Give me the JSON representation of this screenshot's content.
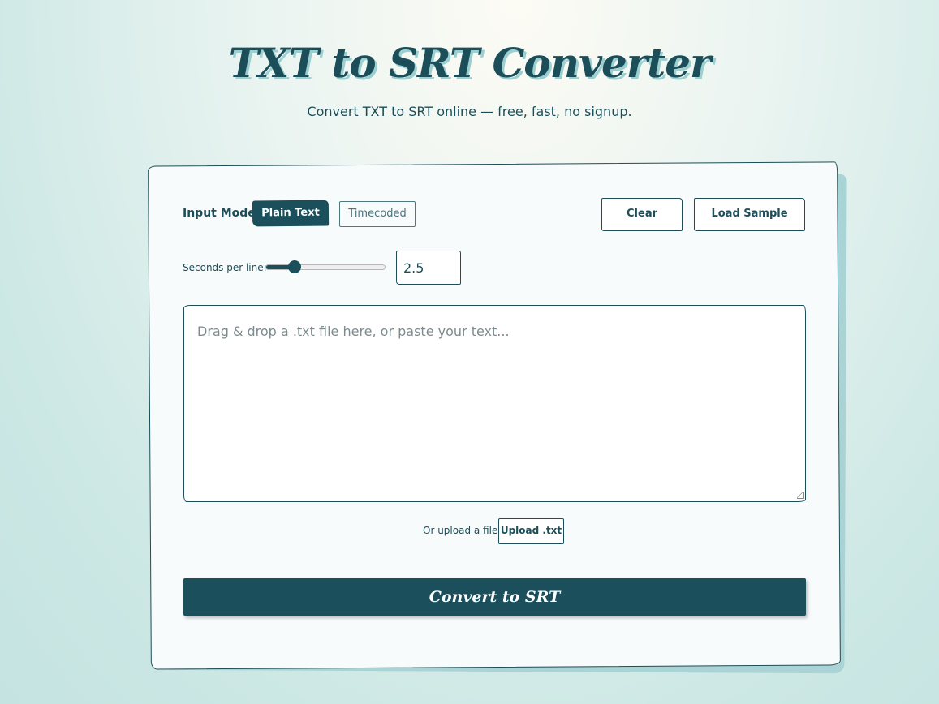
{
  "header": {
    "title": "TXT to SRT Converter",
    "subtitle": "Convert TXT to SRT online — free, fast, no signup."
  },
  "controls": {
    "input_mode_label": "Input Mode:",
    "mode_plain": "Plain Text",
    "mode_timecoded": "Timecoded",
    "active_mode": "Plain Text",
    "clear_label": "Clear",
    "load_sample_label": "Load Sample",
    "seconds_label": "Seconds per line:",
    "seconds_value": "2.5",
    "slider_fraction": 0.24
  },
  "editor": {
    "placeholder": "Drag & drop a .txt file here, or paste your text...",
    "value": ""
  },
  "upload": {
    "label": "Or upload a file:",
    "button_label": "Upload .txt"
  },
  "convert": {
    "button_label": "Convert to SRT"
  },
  "colors": {
    "primary": "#1b4f5b",
    "card_background": "#f7fbfb",
    "page_background": "#cde8e5"
  }
}
